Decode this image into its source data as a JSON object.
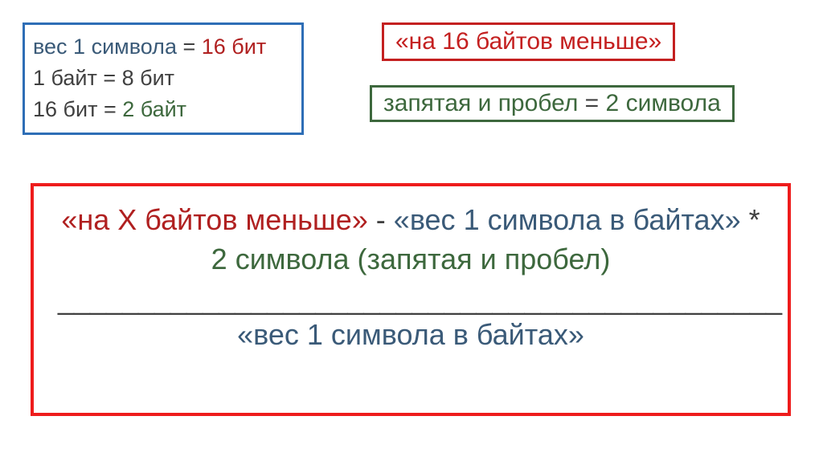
{
  "box_blue": {
    "l1a": "вес 1 символа",
    "l1b": " = ",
    "l1c": "16 бит",
    "l2": "1 байт = 8 бит",
    "l3a": "16 бит = ",
    "l3b": "2 байт"
  },
  "box_red_small": {
    "text": "«на 16 байтов меньше»"
  },
  "box_green": {
    "a": "запятая и пробел",
    "b": " = ",
    "c": "2 символа"
  },
  "box_red_big": {
    "p1a": "«на Х байтов меньше»",
    "p1b": " - ",
    "p1c": "«вес 1 символа в байтах»",
    "p1d": " * ",
    "p1e": "2 символа (запятая и пробел)",
    "hr": "_____________________________________________",
    "p2": "«вес 1 символа в байтах»"
  }
}
